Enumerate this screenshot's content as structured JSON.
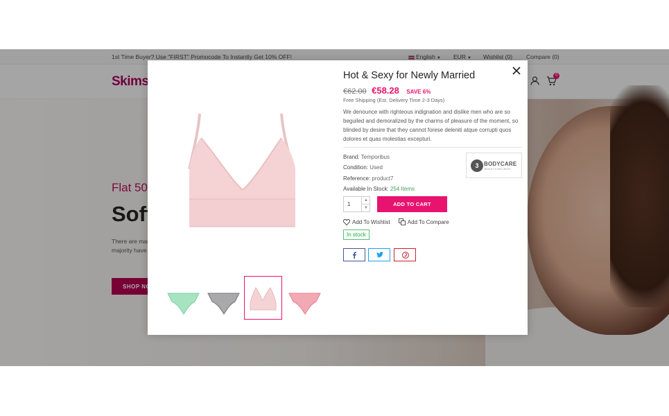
{
  "topbar": {
    "promo": "1st Time Buyer? Use \"FIRST\" Promocode To Instantly Get 10% OFF!",
    "language": "English",
    "currency": "EUR",
    "wishlist": "Wishlist (0)",
    "compare": "Compare (0)"
  },
  "header": {
    "logo": "Skims",
    "cart_count": "0"
  },
  "hero": {
    "subtitle": "Flat 50",
    "title": "Soft",
    "text_line1": "There are mar",
    "text_line2": "majority have",
    "shop_button": "SHOP NO"
  },
  "modal": {
    "title": "Hot & Sexy for Newly Married",
    "old_price": "€62.00",
    "new_price": "€58.28",
    "save": "SAVE 6%",
    "shipping": "Free Shipping (Est. Delivery Time 2-3 Days)",
    "description": "We denounce with righteous indignation and dislike men who are so beguiled and demoralized by the charms of pleasure of the moment, so blinded by desire that they cannot forese deleniti atque corrupti quos dolores et quas molestias excepturi.",
    "brand_label": "Brand:",
    "brand_value": "Temporibus",
    "condition_label": "Condition:",
    "condition_value": "Used",
    "reference_label": "Reference:",
    "reference_value": "product7",
    "stock_label": "Available In Stock:",
    "stock_value": "254 Items",
    "brand_logo_text": "BODYCARE",
    "brand_logo_sub": "BEAUTY & WELLNESS",
    "quantity": "1",
    "add_to_cart": "ADD TO CART",
    "add_to_wishlist": "Add To Wishlist",
    "add_to_compare": "Add To Compare",
    "stock_badge": "In stock"
  },
  "colors": {
    "accent": "#e8136f",
    "brand": "#a6005a",
    "in_stock": "#3aa35a",
    "facebook": "#3b5998",
    "twitter": "#1da1f2",
    "pinterest": "#cb2027"
  },
  "icons": [
    "close-icon",
    "heart-icon",
    "compare-icon",
    "facebook-icon",
    "twitter-icon",
    "pinterest-icon",
    "user-icon",
    "cart-icon"
  ]
}
